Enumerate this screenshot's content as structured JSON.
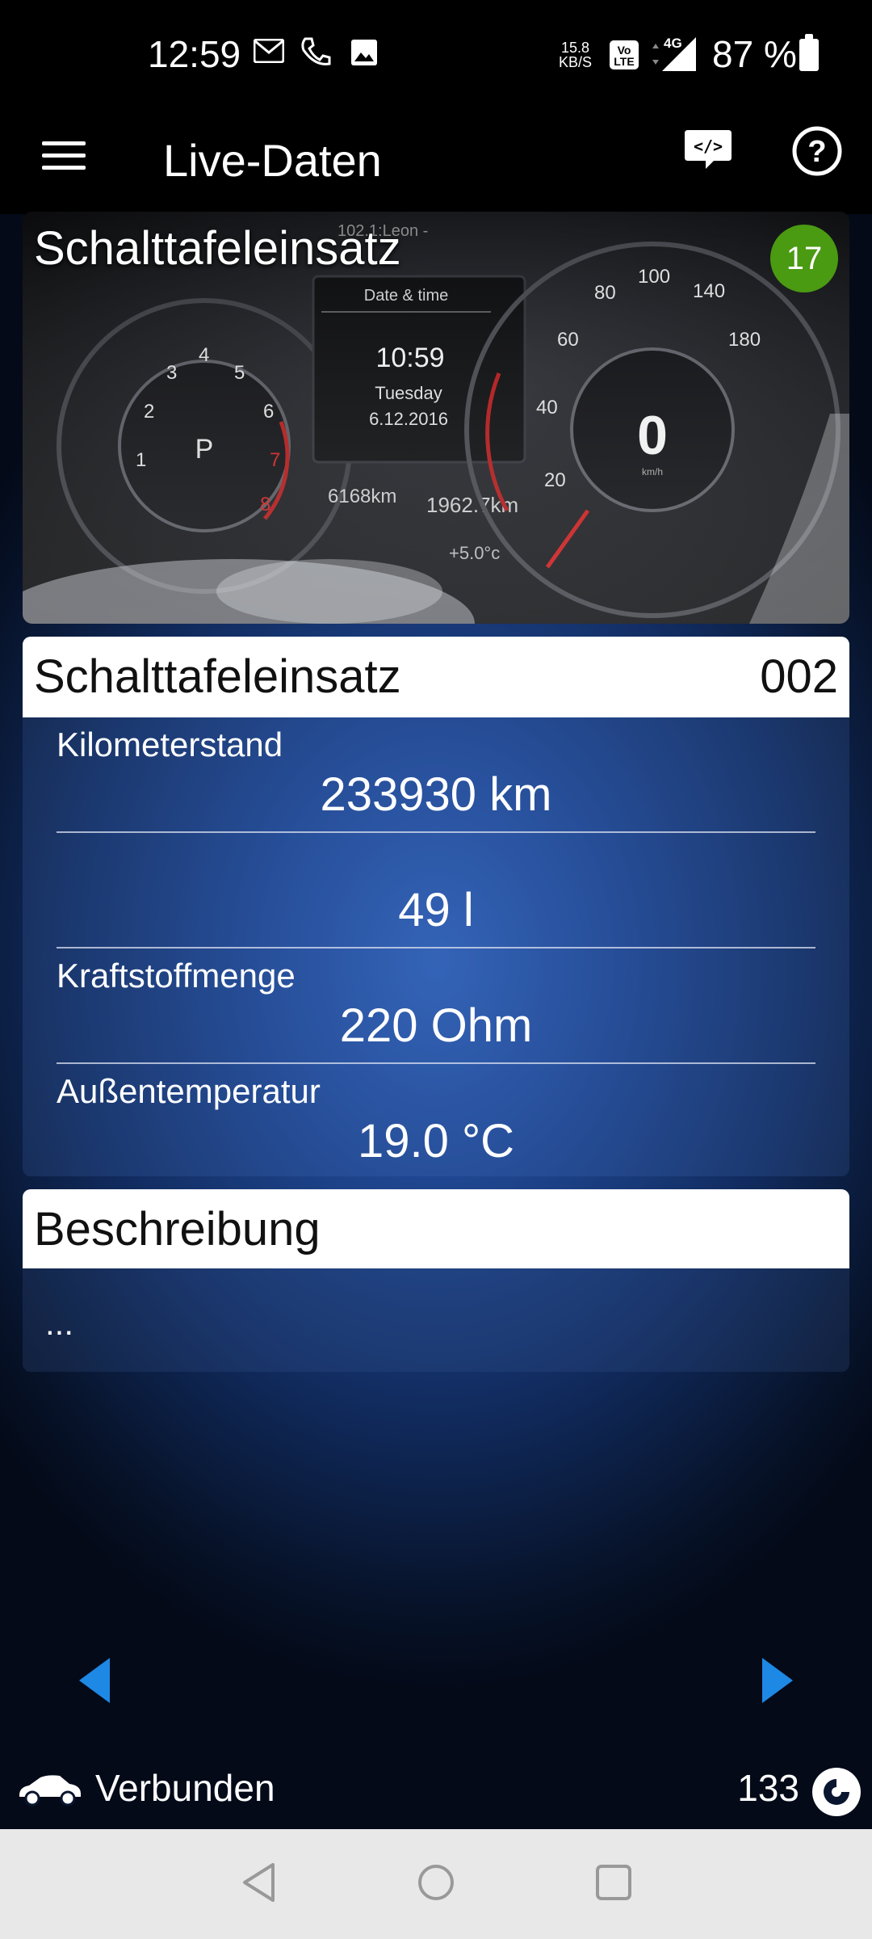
{
  "status_bar": {
    "time": "12:59",
    "notification_icons": [
      "mail-icon",
      "phone-missed-icon",
      "image-icon"
    ],
    "net_speed_value": "15.8",
    "net_speed_unit": "KB/S",
    "volte_label": "Vo LTE",
    "network_label": "4G",
    "battery_percent": "87 %"
  },
  "app_bar": {
    "title": "Live-Daten",
    "menu_icon": "hamburger-menu-icon",
    "code_icon": "code-bubble-icon",
    "code_icon_text": "</>",
    "help_icon": "help-circle-icon",
    "help_icon_text": "?"
  },
  "hero": {
    "title": "Schalttafeleinsatz",
    "badge_count": "17",
    "badge_color": "#4a9a12",
    "cluster_texts": {
      "header": "Date & time",
      "time": "10:59",
      "day": "Tuesday",
      "date": "6.12.2016",
      "odometer": "6168km",
      "trip": "1962.7km",
      "temp": "+5.0°c",
      "speed": "0",
      "speed_unit": "km/h",
      "gear": "P",
      "top_text": "102.1:Leon -",
      "speed_marks": [
        "20",
        "40",
        "60",
        "80",
        "100",
        "140",
        "180"
      ],
      "rpm_marks": [
        "1",
        "2",
        "3",
        "4",
        "5",
        "6",
        "7",
        "8"
      ]
    }
  },
  "data_panel": {
    "title": "Schalttafeleinsatz",
    "code": "002",
    "rows": [
      {
        "label": "Kilometerstand",
        "value": "233930 km"
      },
      {
        "label": "",
        "value": "49 l"
      },
      {
        "label": "Kraftstoffmenge",
        "value": "220 Ohm"
      },
      {
        "label": "Außentemperatur",
        "value": "19.0 °C"
      }
    ]
  },
  "description": {
    "title": "Beschreibung",
    "text": "..."
  },
  "navigation": {
    "prev_icon": "arrow-left-icon",
    "next_icon": "arrow-right-icon",
    "arrow_color": "#1e88e5"
  },
  "footer": {
    "status_label": "Verbunden",
    "count": "133",
    "car_icon": "car-icon",
    "counter_icon": "connection-counter-icon"
  },
  "system_nav": {
    "back_icon": "back-triangle-icon",
    "home_icon": "home-circle-icon",
    "recents_icon": "recents-square-icon"
  }
}
